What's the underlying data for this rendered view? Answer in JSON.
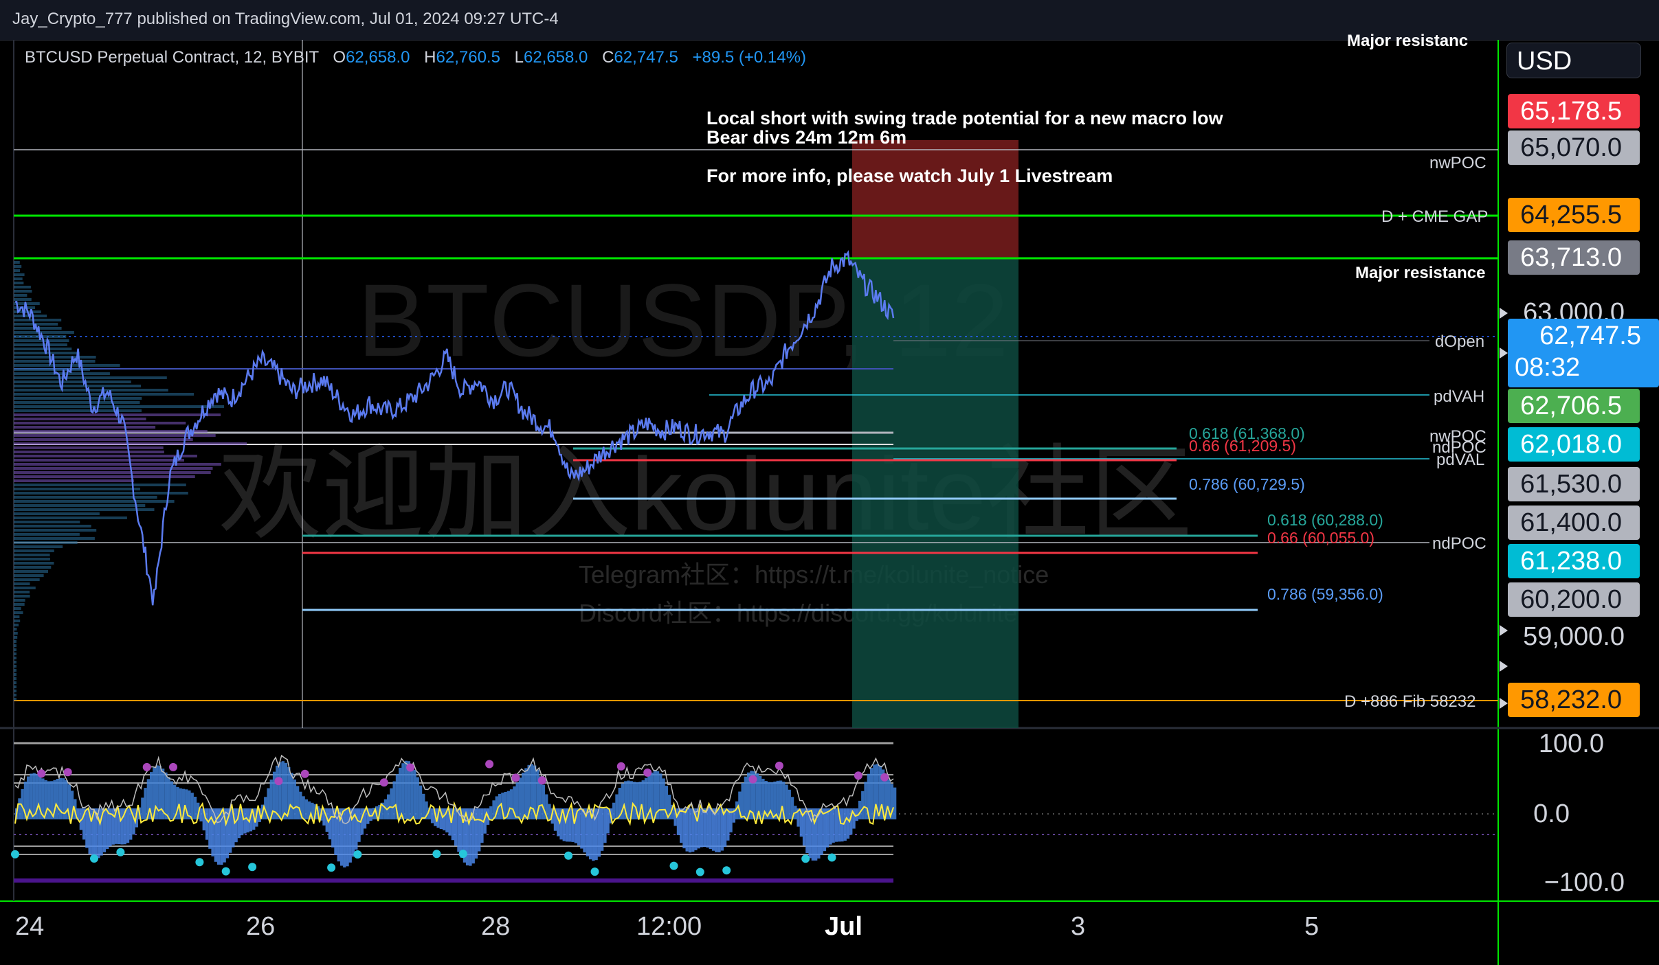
{
  "header": {
    "publish_text": "Jay_Crypto_777 published on TradingView.com, Jul 01, 2024 09:27 UTC-4"
  },
  "legend": {
    "symbol": "BTCUSD Perpetual Contract, 12, BYBIT",
    "o_label": "O",
    "o_value": "62,658.0",
    "h_label": "H",
    "h_value": "62,760.5",
    "l_label": "L",
    "l_value": "62,658.0",
    "c_label": "C",
    "c_value": "62,747.5",
    "change": "+89.5 (+0.14%)"
  },
  "annotation": {
    "line1": "Local short with swing trade potential for a new macro low",
    "line2": "Bear divs 24m 12m 6m",
    "line3": "",
    "line4": "For more info, please watch July 1 Livestream"
  },
  "watermark": {
    "symbol_text": "BTCUSDP, 12",
    "welcome_text": "欢迎加入kolunite社区",
    "telegram": "Telegram社区：https://t.me/kolunite_notice",
    "discord": "Discord社区：https://discord.gg/kolunite"
  },
  "price_axis": {
    "currency": "USD",
    "labels": [
      {
        "text": "65,178.5",
        "color": "#f23645",
        "price": 65178.5
      },
      {
        "text": "65,070.0",
        "color": "#b2b5be",
        "price": 65070.0
      },
      {
        "text": "64,255.5",
        "color": "#ff9800",
        "price": 64255.5
      },
      {
        "text": "63,713.0",
        "color": "#787b86",
        "price": 63713.0
      },
      {
        "text": "62,747.5",
        "color": "#2196f3",
        "price": 62747.5
      },
      {
        "text": "08:32",
        "color": "#2196f3",
        "price": null
      },
      {
        "text": "62,706.5",
        "color": "#4caf50",
        "price": 62706.5
      },
      {
        "text": "62,018.0",
        "color": "#00bcd4",
        "price": 62018.0
      },
      {
        "text": "61,530.0",
        "color": "#b2b5be",
        "price": 61530.0
      },
      {
        "text": "61,400.0",
        "color": "#b2b5be",
        "price": 61400.0
      },
      {
        "text": "61,238.0",
        "color": "#00bcd4",
        "price": 61238.0
      },
      {
        "text": "60,200.0",
        "color": "#b2b5be",
        "price": 60200.0
      },
      {
        "text": "58,232.0",
        "color": "#ff9800",
        "price": 58232.0
      }
    ],
    "plain_labels": [
      "63,000.0",
      "59,000.0"
    ],
    "osc_labels": [
      "100.0",
      "0.0",
      "−100.0"
    ]
  },
  "levels": {
    "major_resistance_top": "Major resistanc",
    "nwpoc": "nwPOC",
    "cme_gap": "D + CME GAP",
    "major_resistance": "Major resistance",
    "dopen": "dOpen",
    "pdvah": "pdVAH",
    "nwpoc2": "nwPOC",
    "ndpoc": "ndPOC",
    "pdval": "pdVAL",
    "ndpoc2": "ndPOC",
    "fib_level": "D +886 Fib 58232"
  },
  "fib_labels": [
    {
      "text": "0.618 (61,368.0)",
      "color": "#26a69a"
    },
    {
      "text": "0.66 (61,209.5)",
      "color": "#f23645"
    },
    {
      "text": "0.786 (60,729.5)",
      "color": "#5b9cf6"
    },
    {
      "text": "0.618 (60,288.0)",
      "color": "#26a69a"
    },
    {
      "text": "0.66 (60,055.0)",
      "color": "#f23645"
    },
    {
      "text": "0.786 (59,356.0)",
      "color": "#5b9cf6"
    }
  ],
  "time_axis": {
    "labels": [
      "24",
      "26",
      "28",
      "12:00",
      "Jul",
      "3",
      "5"
    ]
  },
  "colors": {
    "green_line": "#00e600",
    "orange_line": "#ff9800",
    "red_zone": "#8b1c1c",
    "green_zone": "#0e4a40",
    "price_line": "#5b7bf0"
  },
  "chart_data": {
    "type": "line",
    "title": "BTCUSD Perpetual Contract, 12, BYBIT",
    "xlabel": "",
    "ylabel": "",
    "x_ticks": [
      "24",
      "26",
      "28",
      "12:00",
      "Jul",
      "3",
      "5"
    ],
    "ylim": [
      57500,
      66300
    ],
    "series": [
      {
        "values": [
          62950,
          62800,
          62400,
          61900,
          62300,
          61600,
          61800,
          61400,
          60200,
          59100,
          60700,
          61200,
          61500,
          61800,
          61700,
          61950,
          62200,
          62050,
          61800,
          61900,
          61950,
          61700,
          61500,
          61650,
          61550,
          61600,
          61750,
          61950,
          62250,
          61800,
          61950,
          61700,
          61850,
          61550,
          61400,
          61300,
          60700,
          60800,
          61000,
          61150,
          61250,
          61400,
          61300,
          61350,
          61250,
          61300,
          61250,
          61600,
          61850,
          61900,
          62300,
          62600,
          62900,
          63400,
          63500,
          63200,
          63000,
          62750
        ]
      }
    ],
    "levels": [
      {
        "label": "Major resistance",
        "value": 64255.5
      },
      {
        "label": "Major resistance",
        "value": 63713.0
      },
      {
        "label": "nwPOC",
        "value": 65070.0
      },
      {
        "label": "dOpen",
        "value": 62706.5
      },
      {
        "label": "pdVAH",
        "value": 62018.0
      },
      {
        "label": "ndPOC",
        "value": 61238.0
      },
      {
        "label": "D +886 Fib 58232",
        "value": 58232.0
      }
    ],
    "trade_box": {
      "stop": 65178.5,
      "entry": 63713.0,
      "target": 58232.0
    }
  }
}
